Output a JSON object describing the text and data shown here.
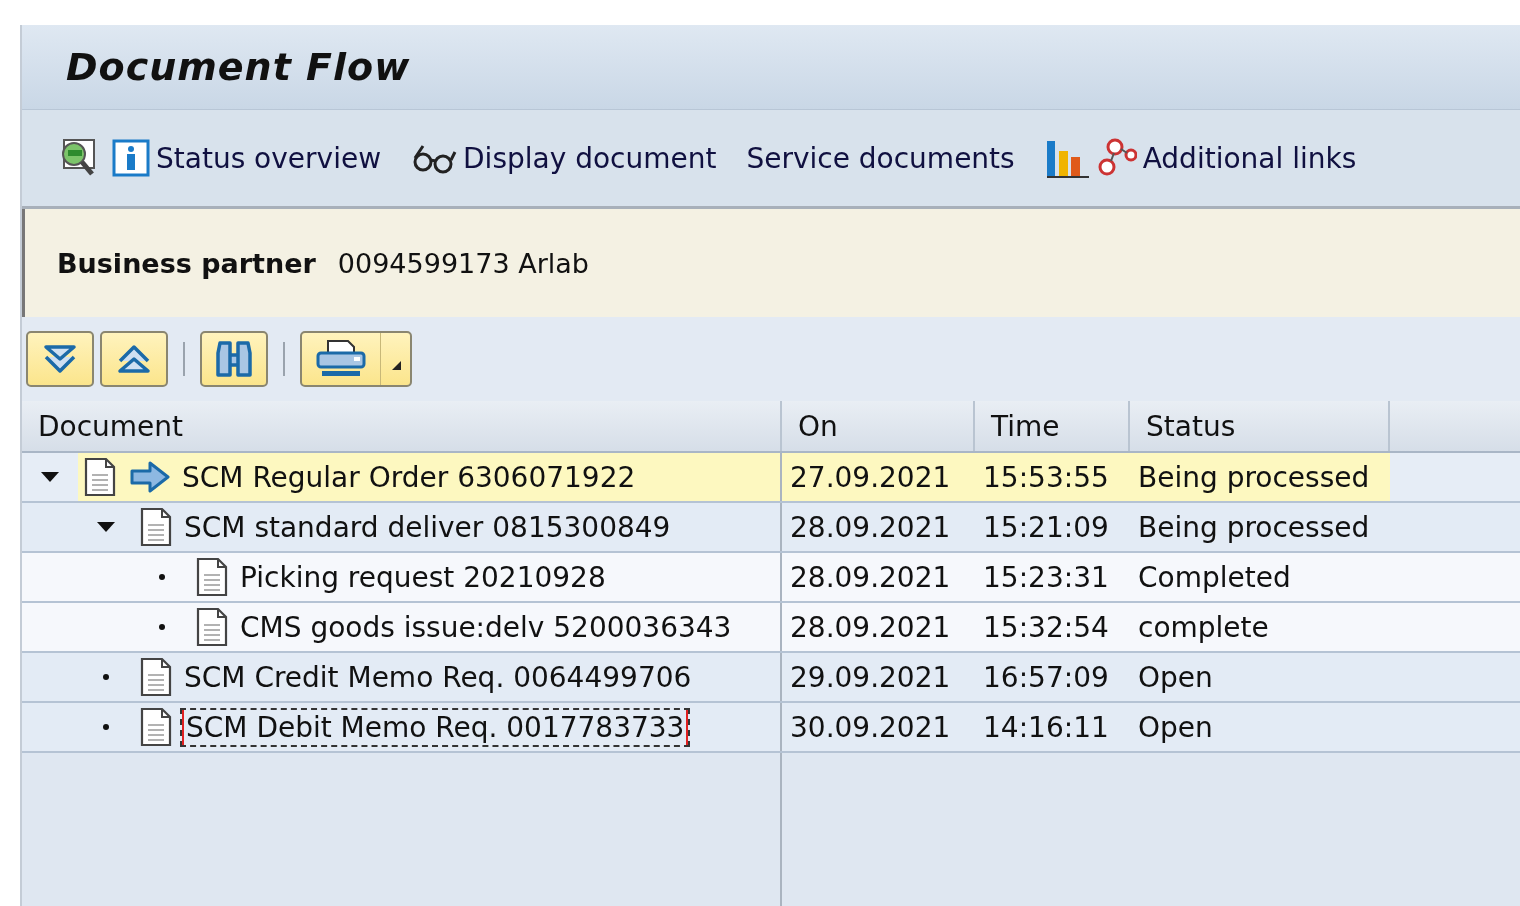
{
  "window": {
    "title": "Document Flow"
  },
  "toolbar": {
    "buttons": [
      "Status overview",
      "Display document",
      "Service documents",
      "Additional links"
    ]
  },
  "header": {
    "label": "Business partner",
    "value": "0094599173 Arlab"
  },
  "table": {
    "columns": [
      "Document",
      "On",
      "Time",
      "Status"
    ],
    "rows": [
      {
        "kind": "node",
        "expanded": true,
        "selected": true,
        "current": true,
        "focused": false,
        "document": "SCM Regular Order 6306071922",
        "on": "27.09.2021",
        "time": "15:53:55",
        "status": "Being processed",
        "children": [
          {
            "kind": "node",
            "expanded": true,
            "selected": false,
            "current": false,
            "focused": false,
            "document": "SCM standard deliver 0815300849",
            "on": "28.09.2021",
            "time": "15:21:09",
            "status": "Being processed",
            "children": [
              {
                "kind": "leaf",
                "selected": false,
                "current": false,
                "focused": false,
                "document": "Picking request 20210928",
                "on": "28.09.2021",
                "time": "15:23:31",
                "status": "Completed"
              },
              {
                "kind": "leaf",
                "selected": false,
                "current": false,
                "focused": false,
                "document": "CMS goods issue:delv 5200036343",
                "on": "28.09.2021",
                "time": "15:32:54",
                "status": "complete"
              }
            ]
          },
          {
            "kind": "leaf",
            "selected": false,
            "current": false,
            "focused": false,
            "document": "SCM Credit Memo Req. 0064499706",
            "on": "29.09.2021",
            "time": "16:57:09",
            "status": "Open"
          },
          {
            "kind": "leaf",
            "selected": false,
            "current": false,
            "focused": true,
            "document": "SCM Debit Memo Req. 0017783733",
            "on": "30.09.2021",
            "time": "14:16:11",
            "status": "Open"
          }
        ]
      }
    ]
  }
}
